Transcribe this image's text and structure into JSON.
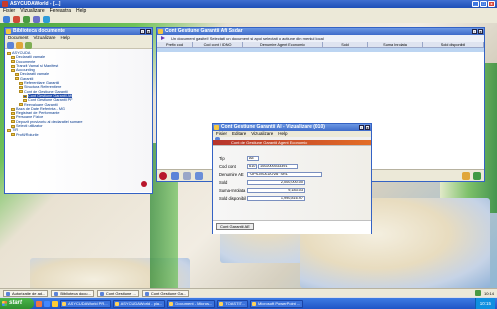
{
  "app": {
    "title": "ASYCUDAWorld - [...]",
    "menu": [
      "Fisier",
      "Vizualizare",
      "Fereastra",
      "Help"
    ]
  },
  "explorer": {
    "title": "Biblioteca documente",
    "menu": [
      "Document",
      "Vizualizare",
      "Help"
    ],
    "items": [
      {
        "label": "ASYCUDA",
        "indent": 0
      },
      {
        "label": "Declaratii vamale",
        "indent": 1
      },
      {
        "label": "Documente",
        "indent": 1
      },
      {
        "label": "Tranzit Vamal si Manifest",
        "indent": 1
      },
      {
        "label": "Accounting",
        "indent": 1
      },
      {
        "label": "Declaratii vamale",
        "indent": 2
      },
      {
        "label": "Garantii",
        "indent": 2
      },
      {
        "label": "Referentiare Garantii",
        "indent": 3
      },
      {
        "label": "Structura Referentiere",
        "indent": 3
      },
      {
        "label": "Cont de Gestiune Garantii",
        "indent": 3
      },
      {
        "label": "Cont Gestiune Garantii Afi",
        "indent": 4,
        "selected": true
      },
      {
        "label": "Cont Gestiune Garantii PF",
        "indent": 4
      },
      {
        "label": "Reevaluare Garantii",
        "indent": 3
      },
      {
        "label": "Baza de Date Referinta - MG",
        "indent": 1
      },
      {
        "label": "Registrari de Performante",
        "indent": 1
      },
      {
        "label": "Persoane Fizice",
        "indent": 1
      },
      {
        "label": "Depozit provizoriu al declaratiei sumare",
        "indent": 1
      },
      {
        "label": "Selecti utilizator",
        "indent": 1
      },
      {
        "label": "TIR",
        "indent": 0
      },
      {
        "label": "Profil/Rolurile",
        "indent": 1
      }
    ]
  },
  "cont": {
    "title": "Cont Gestiune Garantii Afi Ssdar",
    "info": "Un document gasitel! Selectati un document si apoi selectati o actiune din meniul local",
    "columns": [
      "Prefix cod",
      "Cod cont / IDNO",
      "Denumire Agent Economic",
      "Sold",
      "Suma Inrolata",
      "Sold disponibil"
    ]
  },
  "popup": {
    "title": "Cont Gestiune Garantii Al - Vizualizare (010)",
    "menu": [
      "Fisier",
      "Editare",
      "Vizualizare",
      "Help"
    ],
    "banner": "Cont de Gestiune Garantii Agent Economic",
    "fields": [
      {
        "label": "Tip",
        "value": "AE"
      },
      {
        "label": "Cod cont",
        "prefix": "610",
        "value": "1002000033391"
      },
      {
        "label": "Denumire AE",
        "value": "\"UPS-MOLDOVA\" SRL"
      },
      {
        "label": "Sold",
        "value": "2,000,000.00"
      },
      {
        "label": "Suma-Inrolata",
        "value": "9,183.03"
      },
      {
        "label": "Sold disponibil",
        "value": "1,990,816.97"
      }
    ],
    "tab": "Cont Garantii AE"
  },
  "mdi": {
    "items": [
      "Autorizatie de ad...",
      "Biblioteca docu...",
      "Cont Gestiune ...",
      "Cont Gestiune Ga..."
    ],
    "time": "10:14"
  },
  "taskbar": {
    "start": "start",
    "tasks": [
      "ASYCUDAWorld PR...",
      "ASYCUDAWorld - pla...",
      "Document - Micros...",
      "TOASTIT...",
      "Microsoft PowerPoint ..."
    ],
    "clock": "10:15"
  }
}
